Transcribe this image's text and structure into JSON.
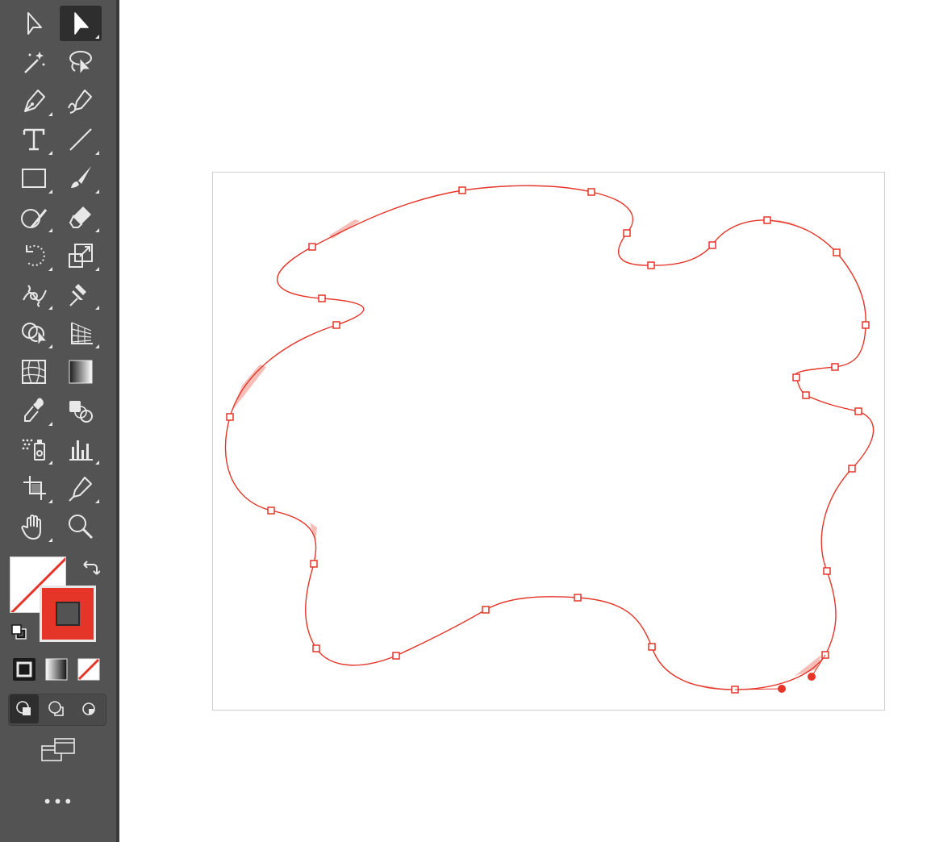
{
  "app": {
    "tool_icons": [
      "direct-selection-icon",
      "selection-icon",
      "magic-wand-icon",
      "lasso-icon",
      "pen-icon",
      "curvature-icon",
      "type-icon",
      "line-segment-icon",
      "rectangle-icon",
      "paintbrush-icon",
      "shaper-icon",
      "eraser-icon",
      "rotate-icon",
      "scale-icon",
      "warp-icon",
      "puppet-warp-icon",
      "shape-builder-icon",
      "perspective-grid-icon",
      "mesh-icon",
      "gradient-icon",
      "eyedropper-icon",
      "blend-icon",
      "symbol-sprayer-icon",
      "column-graph-icon",
      "artboard-icon",
      "slice-icon",
      "hand-icon",
      "zoom-icon"
    ],
    "active_tool": "selection-icon",
    "toolbar_color": "#535353",
    "accent_color": "#e53529"
  },
  "colors": {
    "fill": "none",
    "stroke": "#e53529"
  },
  "more_tools_label": "•••"
}
